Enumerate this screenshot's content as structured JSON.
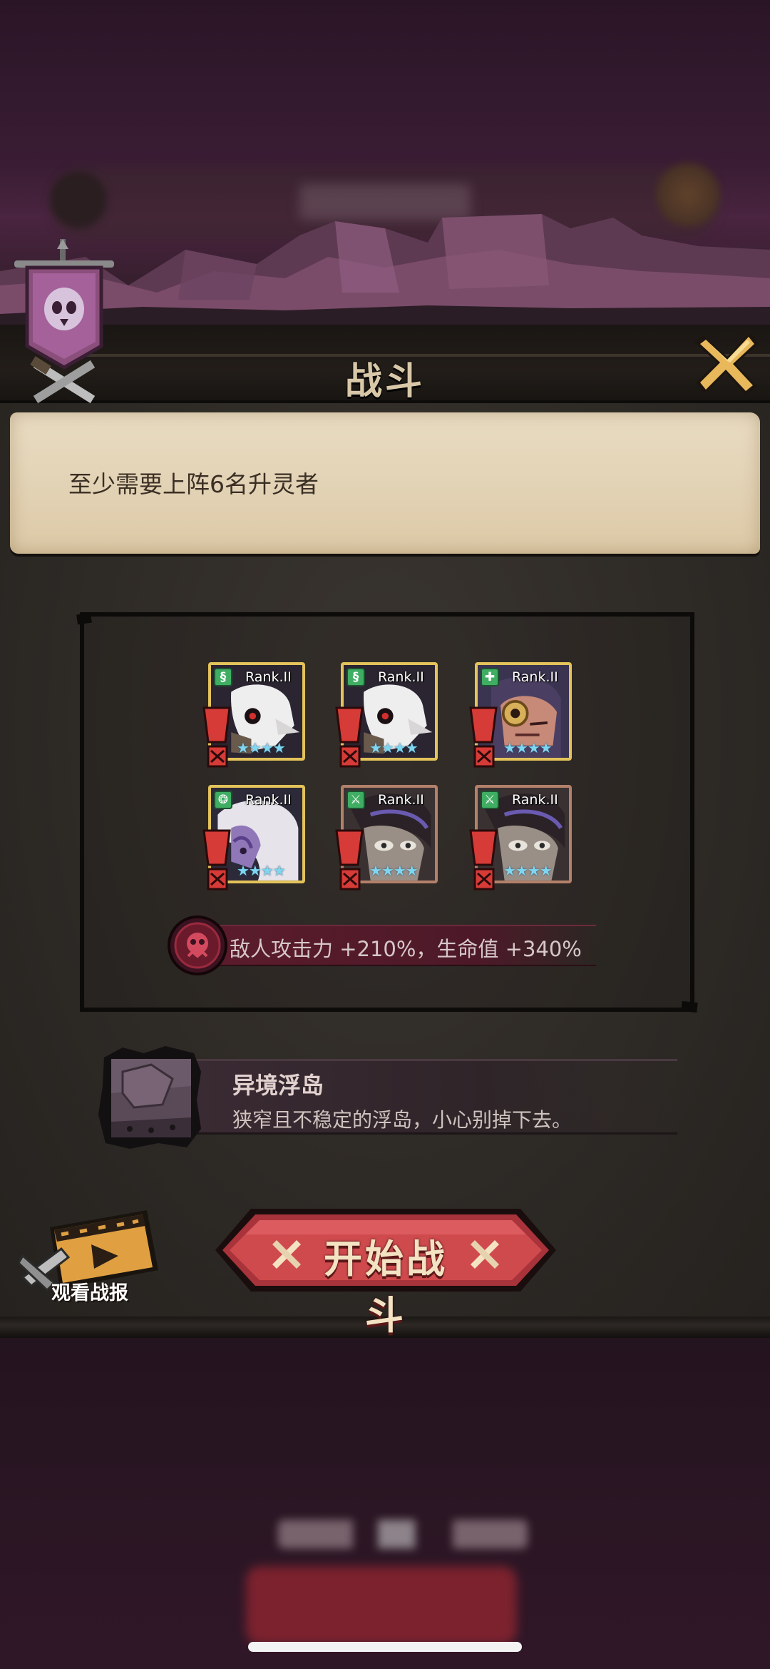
{
  "dialog": {
    "title": "战斗",
    "notice": "至少需要上阵6名升灵者",
    "close_icon": "close-x-icon"
  },
  "team": {
    "heroes": [
      {
        "rank": "Rank.II",
        "stars": "★★★★",
        "frame": "gold",
        "class": "ranger",
        "portrait": "masked-bird"
      },
      {
        "rank": "Rank.II",
        "stars": "★★★★",
        "frame": "gold",
        "class": "ranger",
        "portrait": "masked-bird"
      },
      {
        "rank": "Rank.II",
        "stars": "★★★★",
        "frame": "gold",
        "class": "healer",
        "portrait": "one-eye"
      },
      {
        "rank": "Rank.II",
        "stars": "★★★★",
        "frame": "gold",
        "class": "mage",
        "portrait": "white-hair"
      },
      {
        "rank": "Rank.II",
        "stars": "★★★★",
        "frame": "bronze",
        "class": "warrior",
        "portrait": "hooded"
      },
      {
        "rank": "Rank.II",
        "stars": "★★★★",
        "frame": "bronze",
        "class": "warrior",
        "portrait": "hooded"
      }
    ],
    "enemy_buff": "敌人攻击力 +210%，生命值 +340%"
  },
  "stage": {
    "name": "异境浮岛",
    "description": "狭窄且不稳定的浮岛，小心别掉下去。"
  },
  "actions": {
    "replay_label": "观看战报",
    "start_label": "开始战斗"
  },
  "colors": {
    "accent_red": "#c9413f",
    "gold_frame": "#e3c35a",
    "bronze_frame": "#b3806a",
    "parchment": "#e3d3b6"
  }
}
